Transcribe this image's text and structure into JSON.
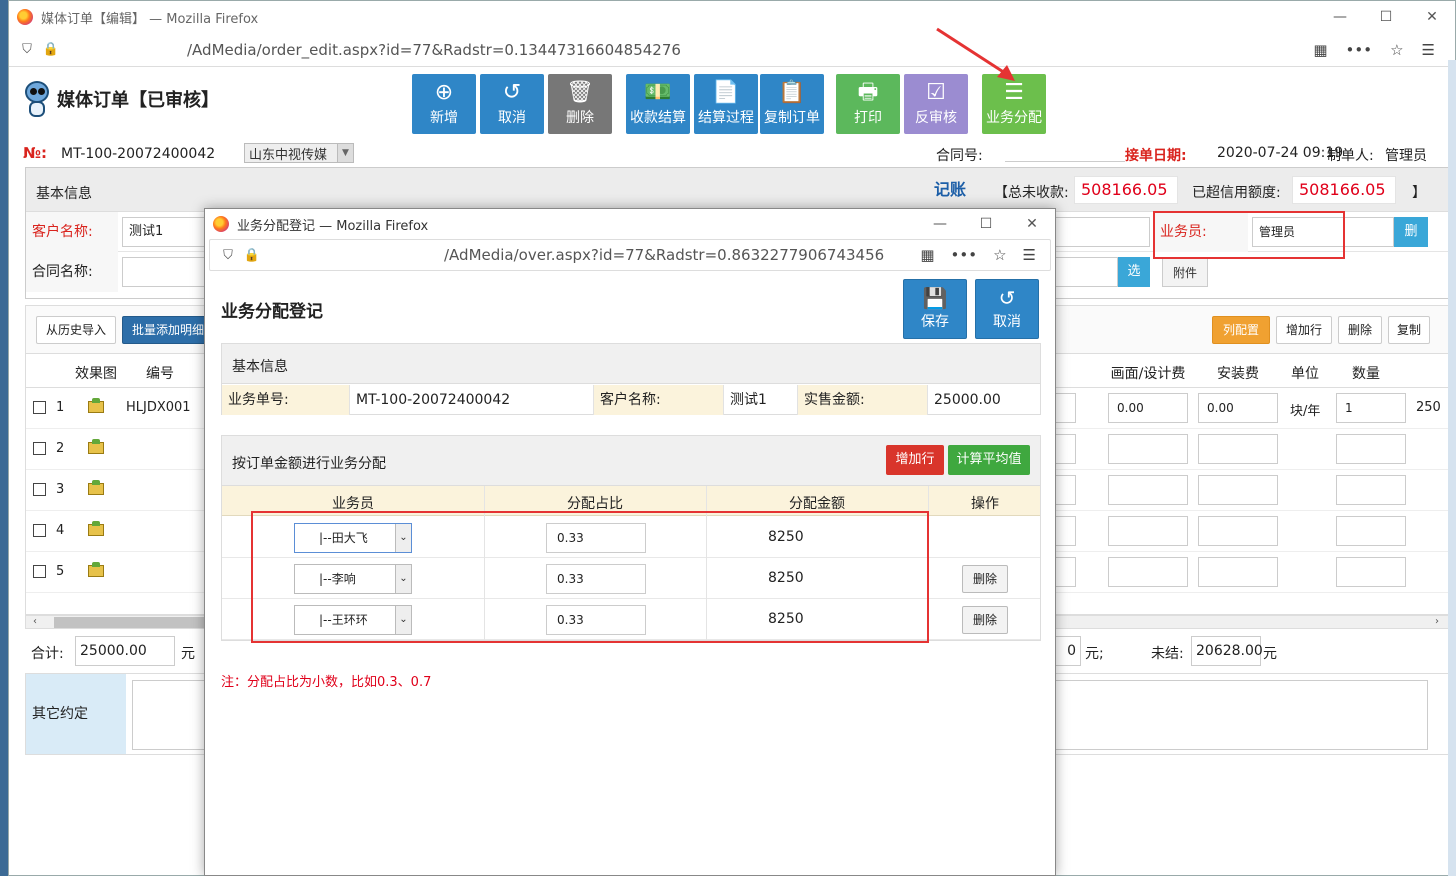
{
  "browser": {
    "title": "媒体订单【编辑】 — Mozilla Firefox",
    "url": "/AdMedia/order_edit.aspx?id=77&Radstr=0.13447316604854276"
  },
  "page": {
    "title": "媒体订单【已审核】",
    "toolbar": [
      {
        "label": "新增",
        "icon": "plus-circle-icon",
        "glyph": "⊕"
      },
      {
        "label": "取消",
        "icon": "undo-icon",
        "glyph": "↺"
      },
      {
        "label": "删除",
        "icon": "trash-icon",
        "glyph": "🗑"
      },
      {
        "label": "收款结算",
        "icon": "money-icon",
        "glyph": "💵"
      },
      {
        "label": "结算过程",
        "icon": "document-icon",
        "glyph": "📄"
      },
      {
        "label": "复制订单",
        "icon": "copy-icon",
        "glyph": "📋"
      },
      {
        "label": "打印",
        "icon": "print-icon",
        "glyph": "🖶"
      },
      {
        "label": "反审核",
        "icon": "check-square-icon",
        "glyph": "☑"
      },
      {
        "label": "业务分配",
        "icon": "list-icon",
        "glyph": "☰"
      }
    ],
    "order_no_label": "№:",
    "order_no": "MT-100-20072400042",
    "media_select": "山东中视传媒",
    "contract_no_label": "合同号:",
    "accept_date_label": "接单日期:",
    "accept_date": "2020-07-24 09:19",
    "creator_label": "制单人:",
    "creator": "管理员"
  },
  "basic": {
    "title": "基本信息",
    "jizhang": "记账",
    "total_unreceived_label": "【总未收款:",
    "total_unreceived": "508166.05",
    "over_credit_label": "已超信用额度:",
    "over_credit": "508166.05",
    "close_bracket": "】",
    "customer_label": "客户名称:",
    "customer_value": "测试1",
    "contract_name_label": "合同名称:",
    "salesman_label": "业务员:",
    "salesman_value": "管理员",
    "del_short": "删",
    "select_short": "选",
    "attach": "附件"
  },
  "toolbar2": {
    "import_history": "从历史导入",
    "batch_add": "批量添加明细",
    "col_config": "列配置",
    "add_row": "增加行",
    "delete": "删除",
    "copy": "复制"
  },
  "grid": {
    "headers": [
      "效果图",
      "编号",
      "画面/设计费",
      "安装费",
      "单位",
      "数量"
    ],
    "rows": [
      {
        "n": "1",
        "code": "HLJDX001",
        "design": "0.00",
        "install": "0.00",
        "unit": "块/年",
        "qty": "1",
        "price": "250"
      },
      {
        "n": "2"
      },
      {
        "n": "3"
      },
      {
        "n": "4"
      },
      {
        "n": "5"
      }
    ]
  },
  "totals": {
    "sum_label": "合计:",
    "sum_value": "25000.00",
    "yuan": "元",
    "partial_value": "0",
    "yuan_semi": "元;",
    "unsettled_label": "未结:",
    "unsettled_value": "20628.00"
  },
  "other": {
    "label": "其它约定"
  },
  "popup": {
    "title": "业务分配登记 — Mozilla Firefox",
    "url": "/AdMedia/over.aspx?id=77&Radstr=0.8632277906743456",
    "heading": "业务分配登记",
    "save": "保存",
    "cancel": "取消",
    "basic_title": "基本信息",
    "order_no_label": "业务单号:",
    "order_no": "MT-100-20072400042",
    "customer_label": "客户名称:",
    "customer": "测试1",
    "amount_label": "实售金额:",
    "amount": "25000.00",
    "alloc_title": "按订单金额进行业务分配",
    "add_row": "增加行",
    "calc_avg": "计算平均值",
    "col_salesman": "业务员",
    "col_ratio": "分配占比",
    "col_amount": "分配金额",
    "col_ops": "操作",
    "rows": [
      {
        "salesman": "|--田大飞",
        "ratio": "0.33",
        "amount": "8250",
        "op": ""
      },
      {
        "salesman": "|--李响",
        "ratio": "0.33",
        "amount": "8250",
        "op": "删除"
      },
      {
        "salesman": "|--王环环",
        "ratio": "0.33",
        "amount": "8250",
        "op": "删除"
      }
    ],
    "note": "注：分配占比为小数，比如0.3、0.7"
  }
}
